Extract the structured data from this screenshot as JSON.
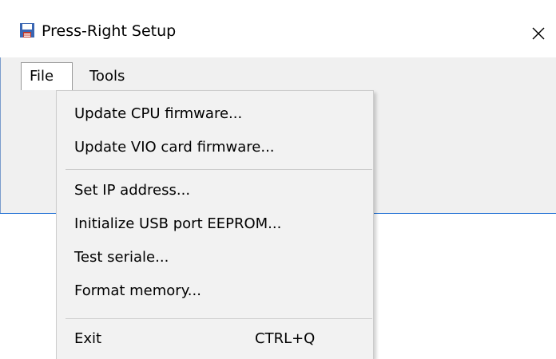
{
  "window": {
    "title": "Press-Right Setup",
    "icon": "floppy-disk-icon",
    "close_glyph": "close-icon"
  },
  "menubar": {
    "items": [
      {
        "label": "File",
        "active": true
      },
      {
        "label": "Tools",
        "active": false
      }
    ]
  },
  "file_menu": {
    "items": [
      {
        "label": "Update CPU firmware..."
      },
      {
        "label": "Update VIO card firmware..."
      },
      {
        "label": "Set IP address..."
      },
      {
        "label": "Initialize USB port EEPROM..."
      },
      {
        "label": "Test seriale..."
      },
      {
        "label": "Format memory..."
      },
      {
        "label": "Exit",
        "shortcut": "CTRL+Q"
      }
    ]
  },
  "colors": {
    "client_background": "#f0f0f0",
    "menu_background": "#f2f2f2",
    "accent_border": "#1e6fd4"
  }
}
